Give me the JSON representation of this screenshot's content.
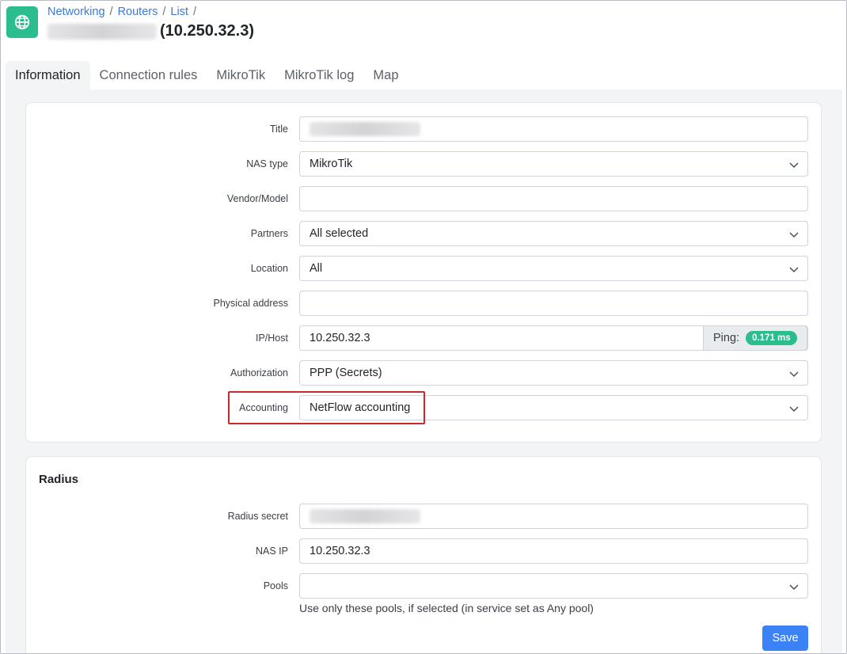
{
  "breadcrumb": {
    "items": [
      "Networking",
      "Routers",
      "List"
    ],
    "separator": "/"
  },
  "page": {
    "title_suffix": "(10.250.32.3)",
    "icon": "globe-icon"
  },
  "tabs": [
    {
      "label": "Information",
      "active": true
    },
    {
      "label": "Connection rules",
      "active": false
    },
    {
      "label": "MikroTik",
      "active": false
    },
    {
      "label": "MikroTik log",
      "active": false
    },
    {
      "label": "Map",
      "active": false
    }
  ],
  "form": {
    "title": {
      "label": "Title",
      "value": ""
    },
    "nas_type": {
      "label": "NAS type",
      "value": "MikroTik"
    },
    "vendor_model": {
      "label": "Vendor/Model",
      "value": ""
    },
    "partners": {
      "label": "Partners",
      "value": "All selected"
    },
    "location": {
      "label": "Location",
      "value": "All"
    },
    "physical_address": {
      "label": "Physical address",
      "value": ""
    },
    "ip_host": {
      "label": "IP/Host",
      "value": "10.250.32.3",
      "ping_label": "Ping:",
      "ping_value": "0.171 ms"
    },
    "authorization": {
      "label": "Authorization",
      "value": "PPP (Secrets)"
    },
    "accounting": {
      "label": "Accounting",
      "value": "NetFlow accounting"
    }
  },
  "radius": {
    "heading": "Radius",
    "secret": {
      "label": "Radius secret",
      "value": ""
    },
    "nas_ip": {
      "label": "NAS IP",
      "value": "10.250.32.3"
    },
    "pools": {
      "label": "Pools",
      "value": "",
      "help": "Use only these pools, if selected (in service set as Any pool)"
    },
    "save_label": "Save"
  },
  "colors": {
    "accent": "#3b82f6",
    "brand_green": "#2bbd8e",
    "link": "#3b79d6",
    "highlight": "#c6282d"
  }
}
